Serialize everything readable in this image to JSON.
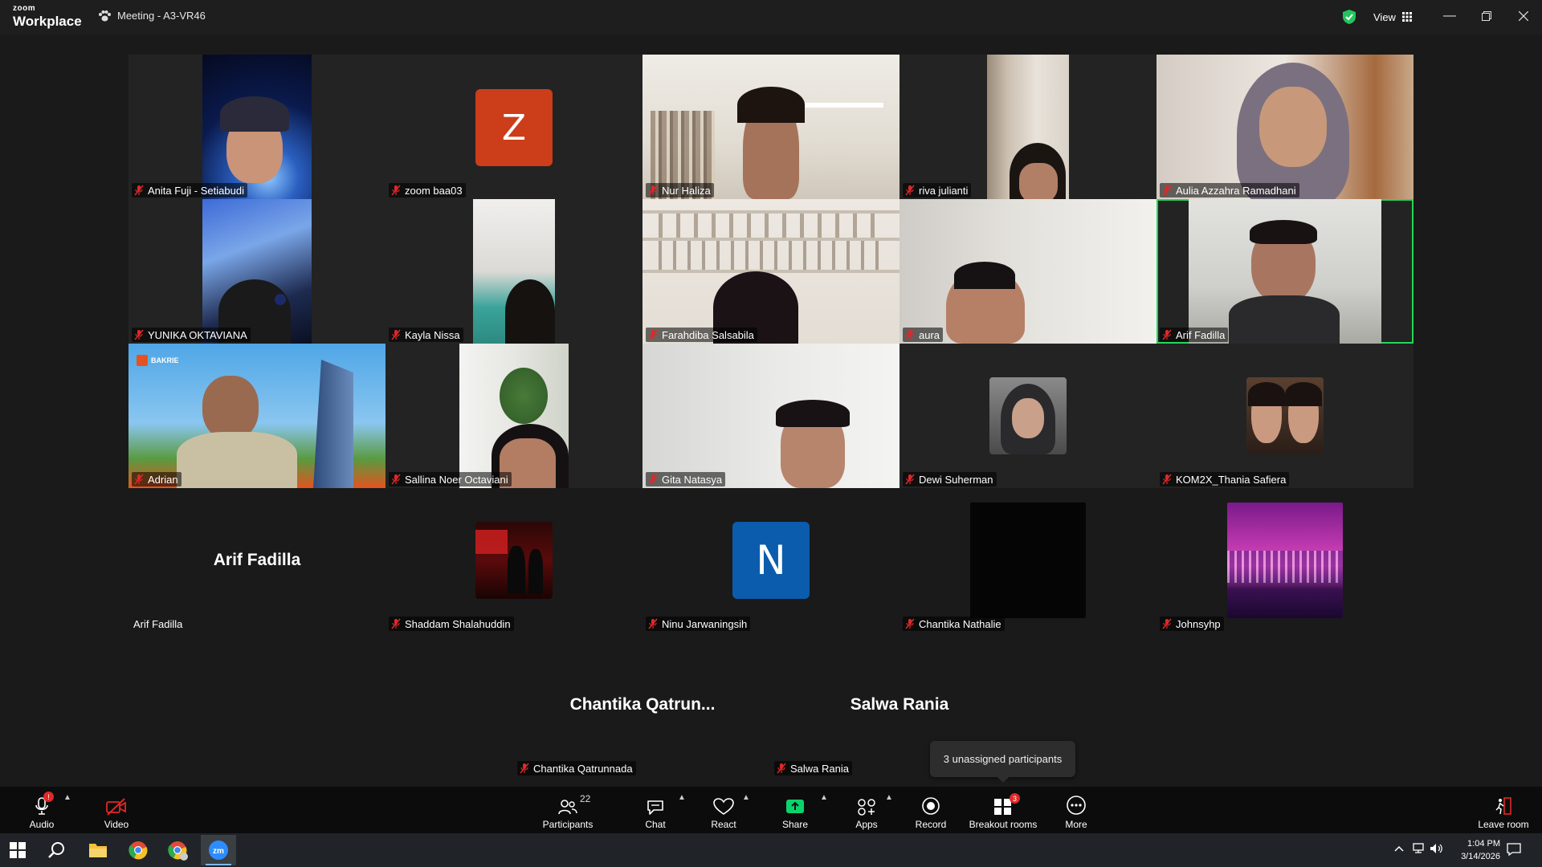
{
  "titlebar": {
    "logo_top": "zoom",
    "logo_bottom": "Workplace",
    "meeting_title": "Meeting - A3-VR46",
    "view_label": "View"
  },
  "tiles": [
    {
      "name": "Anita Fuji - Setiabudi"
    },
    {
      "name": "zoom baa03",
      "avatar": "Z"
    },
    {
      "name": "Nur Haliza"
    },
    {
      "name": "riva julianti"
    },
    {
      "name": "Aulia Azzahra Ramadhani"
    },
    {
      "name": "YUNIKA OKTAVIANA"
    },
    {
      "name": "Kayla Nissa"
    },
    {
      "name": "Farahdiba Salsabila"
    },
    {
      "name": "aura"
    },
    {
      "name": "Arif Fadilla"
    },
    {
      "name": "Adrian",
      "logo_text": "BAKRIE"
    },
    {
      "name": "Sallina Noer Octaviani"
    },
    {
      "name": "Gita Natasya"
    },
    {
      "name": "Dewi Suherman"
    },
    {
      "name": "KOM2X_Thania Safiera"
    },
    {
      "name": "Arif Fadilla",
      "center_name": "Arif Fadilla"
    },
    {
      "name": "Shaddam Shalahuddin"
    },
    {
      "name": "Ninu Jarwaningsih",
      "avatar": "N"
    },
    {
      "name": "Chantika Nathalie"
    },
    {
      "name": "Johnsyhp"
    },
    {
      "name": "Chantika Qatrunnada",
      "center_name": "Chantika  Qatrun..."
    },
    {
      "name": "Salwa Rania",
      "center_name": "Salwa Rania"
    }
  ],
  "tooltip": "3 unassigned participants",
  "toolbar": {
    "audio": "Audio",
    "audio_badge": "!",
    "video": "Video",
    "participants": "Participants",
    "participants_count": "22",
    "chat": "Chat",
    "react": "React",
    "share": "Share",
    "apps": "Apps",
    "record": "Record",
    "breakout": "Breakout rooms",
    "breakout_badge": "3",
    "more": "More",
    "leave": "Leave room"
  },
  "taskbar": {
    "time": "1:04 PM",
    "date": "3/14/2026"
  },
  "colors": {
    "talking_border": "#23d959",
    "muted_red": "#e02828",
    "avatar_z": "#cc3d1a",
    "avatar_n": "#0b5cad",
    "share_green": "#0bd36c"
  }
}
